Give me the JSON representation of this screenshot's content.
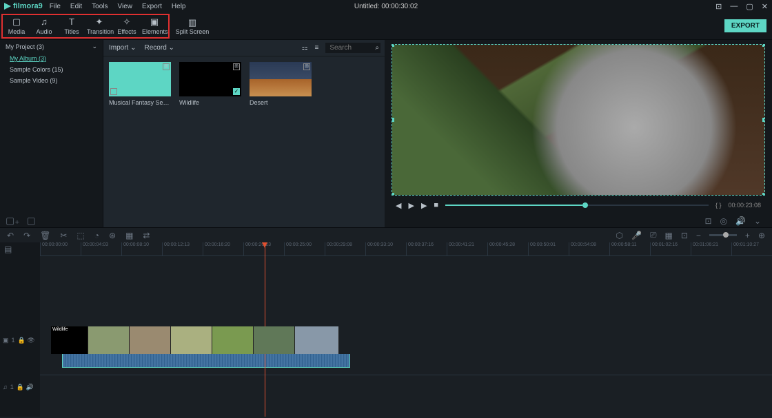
{
  "app": {
    "name": "filmora9",
    "title": "Untitled:  00:00:30:02"
  },
  "menu": [
    "File",
    "Edit",
    "Tools",
    "View",
    "Export",
    "Help"
  ],
  "tabs": [
    {
      "label": "Media",
      "icon": "▢"
    },
    {
      "label": "Audio",
      "icon": "♫"
    },
    {
      "label": "Titles",
      "icon": "T"
    },
    {
      "label": "Transition",
      "icon": "✦"
    },
    {
      "label": "Effects",
      "icon": "✧"
    },
    {
      "label": "Elements",
      "icon": "▣"
    }
  ],
  "split": "Split Screen",
  "export": "EXPORT",
  "sidebar": {
    "header": "My Project (3)",
    "items": [
      "My Album (3)",
      "Sample Colors (15)",
      "Sample Video (9)"
    ]
  },
  "midbar": {
    "import": "Import",
    "record": "Record",
    "search": "Search"
  },
  "thumbs": [
    {
      "label": "Musical Fantasy Set_Film..."
    },
    {
      "label": "Wildlife"
    },
    {
      "label": "Desert"
    }
  ],
  "preview": {
    "time": "00:00:23:08"
  },
  "timeline": {
    "ticks": [
      "00:00:00:00",
      "00:00:04:03",
      "00:00:08:10",
      "00:00:12:13",
      "00:00:16:20",
      "00:00:20:23",
      "00:00:25:00",
      "00:00:29:08",
      "00:00:33:10",
      "00:00:37:16",
      "00:00:41:21",
      "00:00:45:28",
      "00:00:50:01",
      "00:00:54:08",
      "00:00:58:11",
      "00:01:02:16",
      "00:01:06:21",
      "00:01:10:27"
    ],
    "video_track": "1",
    "audio_track": "1",
    "clip_label": "Wildlife"
  }
}
